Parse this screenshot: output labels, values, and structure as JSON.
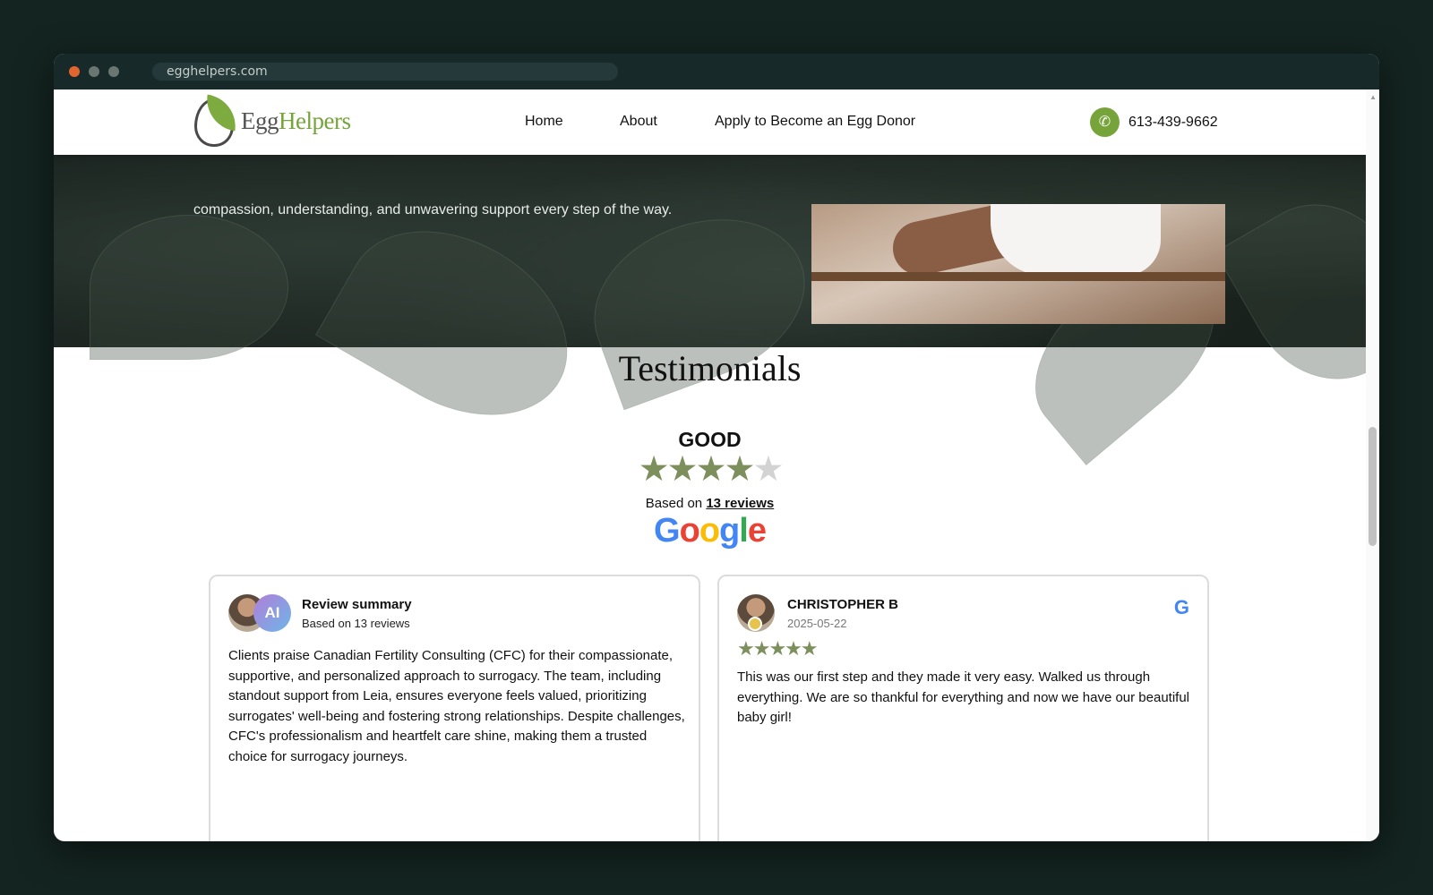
{
  "browser": {
    "url": "egghelpers.com"
  },
  "header": {
    "logo_part1": "Egg",
    "logo_part2": "Helpers",
    "nav": [
      "Home",
      "About",
      "Apply to Become an Egg Donor"
    ],
    "phone": "613-439-9662"
  },
  "hero": {
    "text": "compassion, understanding, and unwavering support every step of the way."
  },
  "testimonials": {
    "title": "Testimonials",
    "rating_word": "GOOD",
    "rating_stars": 4,
    "rating_max": 5,
    "based_on_prefix": "Based on",
    "based_on_link": "13 reviews",
    "source": "Google",
    "cards": [
      {
        "name": "Review summary",
        "subtitle": "Based on 13 reviews",
        "badge": "AI",
        "text": "Clients praise Canadian Fertility Consulting (CFC) for their compassionate, supportive, and personalized approach to surrogacy. The team, including standout support from Leia, ensures everyone feels valued, prioritizing surrogates' well-being and fostering strong relationships. Despite challenges, CFC's professionalism and heartfelt care shine, making them a trusted choice for surrogacy journeys."
      },
      {
        "name": "CHRISTOPHER B",
        "date": "2025-05-22",
        "stars": 5,
        "text": "This was our first step and they made it very easy. Walked us through everything. We are so thankful for everything and now we have our beautiful baby girl!"
      }
    ]
  },
  "colors": {
    "brand_green": "#76a43b",
    "star_green": "#7c8f5c"
  }
}
